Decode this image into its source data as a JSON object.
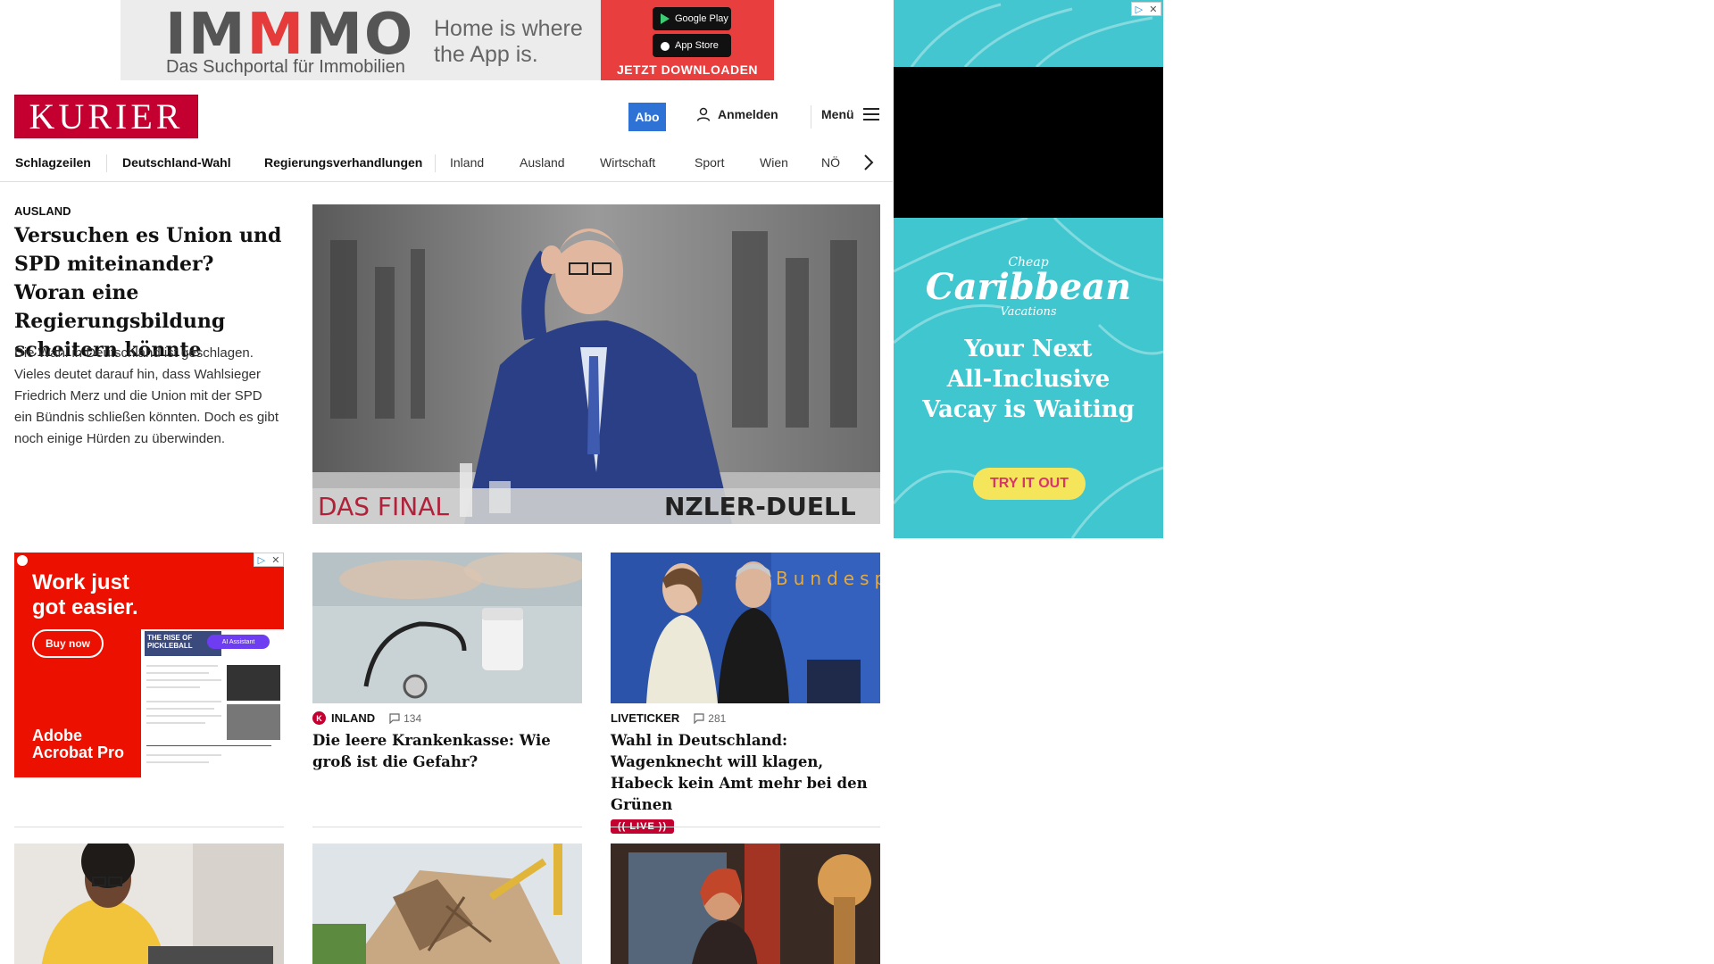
{
  "top_ad": {
    "logo_part1": "IM",
    "logo_part2": "M",
    "logo_part3": "MO",
    "subline": "Das Suchportal für Immobilien",
    "tagline": "Home is where the App is.",
    "google_play": "Google Play",
    "app_store": "App Store",
    "cta": "JETZT DOWNLOADEN"
  },
  "header": {
    "brand": "KURIER",
    "abo": "Abo",
    "login": "Anmelden",
    "menu": "Menü"
  },
  "nav": {
    "items": [
      "Schlagzeilen",
      "Deutschland-Wahl",
      "Regierungsverhandlungen",
      "Inland",
      "Ausland",
      "Wirtschaft",
      "Sport",
      "Wien",
      "NÖ"
    ]
  },
  "lead": {
    "section": "AUSLAND",
    "title": "Versuchen es Union und SPD miteinander? Woran eine Regierungsbildung scheitern könnte",
    "teaser": "Die Wahl in Deutschland ist geschlagen. Vieles deutet darauf hin, dass Wahlsieger Friedrich Merz und die Union mit der SPD ein Bündnis schließen könnten. Doch es gibt noch einige Hürden zu überwinden.",
    "image_caption_left": "DAS FINAL",
    "image_caption_right": "NZLER-DUELL"
  },
  "side_ad": {
    "logo_small": "Cheap",
    "logo_big": "Caribbean",
    "logo_sub": "Vacations",
    "headline_1": "Your Next",
    "headline_2": "All-Inclusive",
    "headline_3": "Vacay is Waiting",
    "cta": "TRY IT OUT"
  },
  "acrobat_ad": {
    "headline_1": "Work just",
    "headline_2": "got easier.",
    "button": "Buy now",
    "doc_title": "THE RISE OF PICKLEBALL",
    "assistant": "AI Assistant",
    "brand_1": "Adobe",
    "brand_2": "Acrobat Pro"
  },
  "cards": [
    {
      "section": "INLAND",
      "comments": "134",
      "title": "Die leere Krankenkasse: Wie groß ist die Gefahr?"
    },
    {
      "section": "LIVETICKER",
      "comments": "281",
      "title": "Wahl in Deutschland: Wagenknecht will klagen, Habeck kein Amt mehr bei den Grünen",
      "badge": "LIVE",
      "image_text": "Bundesp"
    }
  ],
  "colors": {
    "brand_red": "#c3002f",
    "abo_blue": "#2f72d6",
    "ad_teal": "#3fc6cf",
    "acrobat_red": "#eb1000"
  },
  "icons": [
    "user-icon",
    "hamburger-icon",
    "chevron-right-icon",
    "comment-icon",
    "adchoices-icon",
    "close-icon"
  ]
}
